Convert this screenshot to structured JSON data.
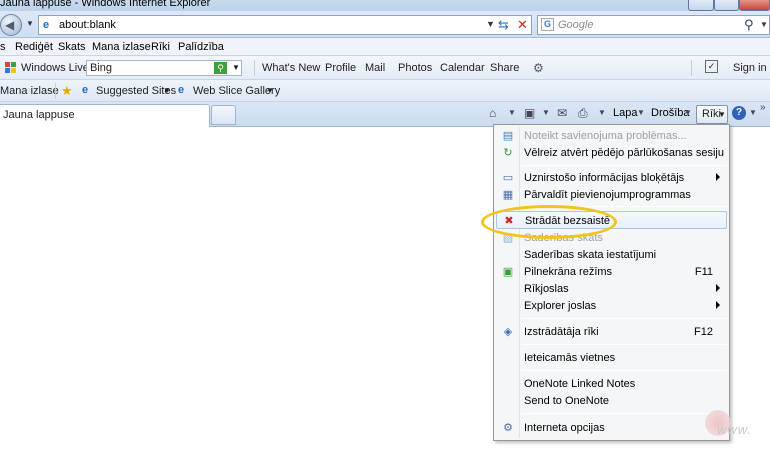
{
  "window": {
    "title": "Jauna lappuse - Windows Internet Explorer"
  },
  "address": {
    "url": "about:blank"
  },
  "search": {
    "placeholder": "Google"
  },
  "menubar": {
    "items": [
      "s",
      "Rediģēt",
      "Skats",
      "Mana izlase",
      "Rīki",
      "Palīdzība"
    ]
  },
  "links": {
    "windows_live": "Windows Live",
    "bing_value": "Bing",
    "items": [
      "What's New",
      "Profile",
      "Mail",
      "Photos",
      "Calendar",
      "Share"
    ],
    "sign_in": "Sign in"
  },
  "favorites": {
    "label": "Mana izlase",
    "suggested": "Suggested Sites",
    "web_slice": "Web Slice Gallery"
  },
  "tab": {
    "title": "Jauna lappuse"
  },
  "commandbar": {
    "page": "Lapa",
    "safety": "Drošība",
    "tools": "Rīki"
  },
  "tools_menu": {
    "items": [
      {
        "label": "Noteikt savienojuma problēmas...",
        "disabled": true,
        "icon": "network-diagnose-icon"
      },
      {
        "label": "Vēlreiz atvērt pēdējo pārlūkošanas sesiju",
        "icon": "reopen-session-icon"
      },
      {
        "label": "Uznirstošo informācijas bloķētājs",
        "submenu": true,
        "icon": "popup-blocker-icon"
      },
      {
        "label": "Pārvaldīt pievienojumprogrammas",
        "icon": "addons-icon"
      },
      {
        "label": "Strādāt bezsaistē",
        "highlighted": true,
        "icon": "work-offline-icon"
      },
      {
        "label": "Saderības skats",
        "disabled": true,
        "icon": "compat-view-icon"
      },
      {
        "label": "Saderības skata iestatījumi"
      },
      {
        "label": "Pilnekrāna režīms",
        "accelerator": "F11",
        "icon": "fullscreen-icon"
      },
      {
        "label": "Rīkjoslas",
        "submenu": true
      },
      {
        "label": "Explorer joslas",
        "submenu": true
      },
      {
        "label": "Izstrādātāja rīki",
        "accelerator": "F12",
        "icon": "developer-tools-icon"
      },
      {
        "label": "Ieteicamās vietnes"
      },
      {
        "label": "OneNote Linked Notes"
      },
      {
        "label": "Send to OneNote"
      },
      {
        "label": "Interneta opcijas",
        "icon": "internet-options-icon"
      }
    ]
  },
  "colors": {
    "highlight_ring": "#f2c31c",
    "accent": "#1e6bc9"
  }
}
